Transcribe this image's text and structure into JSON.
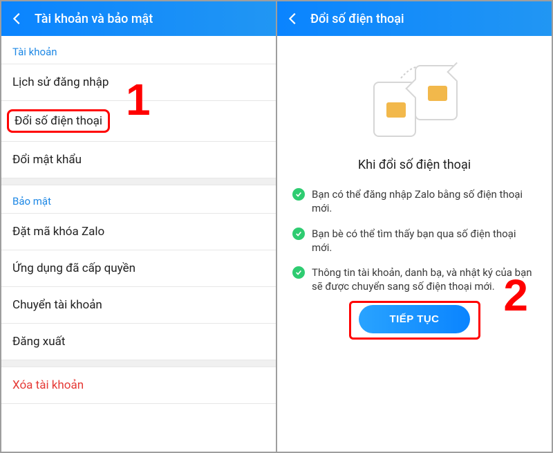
{
  "annotations": {
    "step1": "1",
    "step2": "2"
  },
  "left": {
    "header_title": "Tài khoản và bảo mật",
    "section_account": "Tài khoản",
    "items_account": [
      "Lịch sử đăng nhập",
      "Đổi số điện thoại",
      "Đổi mật khẩu"
    ],
    "section_security": "Bảo mật",
    "items_security": [
      "Đặt mã khóa Zalo",
      "Ứng dụng đã cấp quyền",
      "Chuyển tài khoản",
      "Đăng xuất"
    ],
    "item_delete": "Xóa tài khoản"
  },
  "right": {
    "header_title": "Đổi số điện thoại",
    "heading": "Khi đổi số điện thoại",
    "bullets": [
      "Bạn có thể đăng nhập Zalo bằng số điện thoại mới.",
      "Bạn bè có thể tìm thấy bạn qua số điện thoại mới.",
      "Thông tin tài khoản, danh bạ, và nhật ký của bạn sẽ được chuyển sang số điện thoại mới."
    ],
    "continue_label": "TIẾP TỤC"
  }
}
